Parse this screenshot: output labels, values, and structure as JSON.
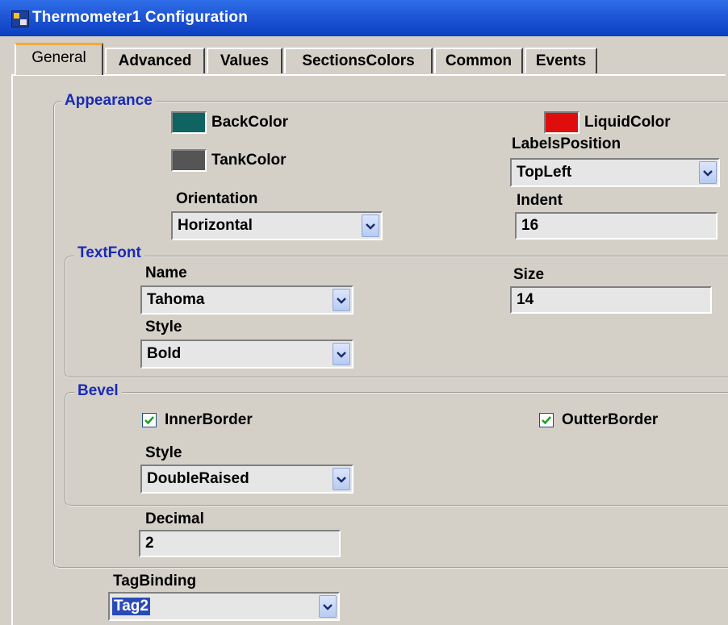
{
  "window": {
    "title": "Thermometer1 Configuration"
  },
  "tabs": [
    "General",
    "Advanced",
    "Values",
    "SectionsColors",
    "Common",
    "Events"
  ],
  "appearance": {
    "title": "Appearance",
    "back_color_label": "BackColor",
    "back_color": "#0f6462",
    "tank_color_label": "TankColor",
    "tank_color": "#555555",
    "liquid_color_label": "LiquidColor",
    "liquid_color": "#e00d0d",
    "labels_position_label": "LabelsPosition",
    "labels_position_value": "TopLeft",
    "orientation_label": "Orientation",
    "orientation_value": "Horizontal",
    "indent_label": "Indent",
    "indent_value": "16"
  },
  "text_font": {
    "title": "TextFont",
    "name_label": "Name",
    "name_value": "Tahoma",
    "size_label": "Size",
    "size_value": "14",
    "style_label": "Style",
    "style_value": "Bold"
  },
  "bevel": {
    "title": "Bevel",
    "inner_border_label": "InnerBorder",
    "inner_border_checked": true,
    "outter_border_label": "OutterBorder",
    "outter_border_checked": true,
    "style_label": "Style",
    "style_value": "DoubleRaised"
  },
  "decimal": {
    "label": "Decimal",
    "value": "2"
  },
  "tag_binding": {
    "label": "TagBinding",
    "value": "Tag2"
  }
}
